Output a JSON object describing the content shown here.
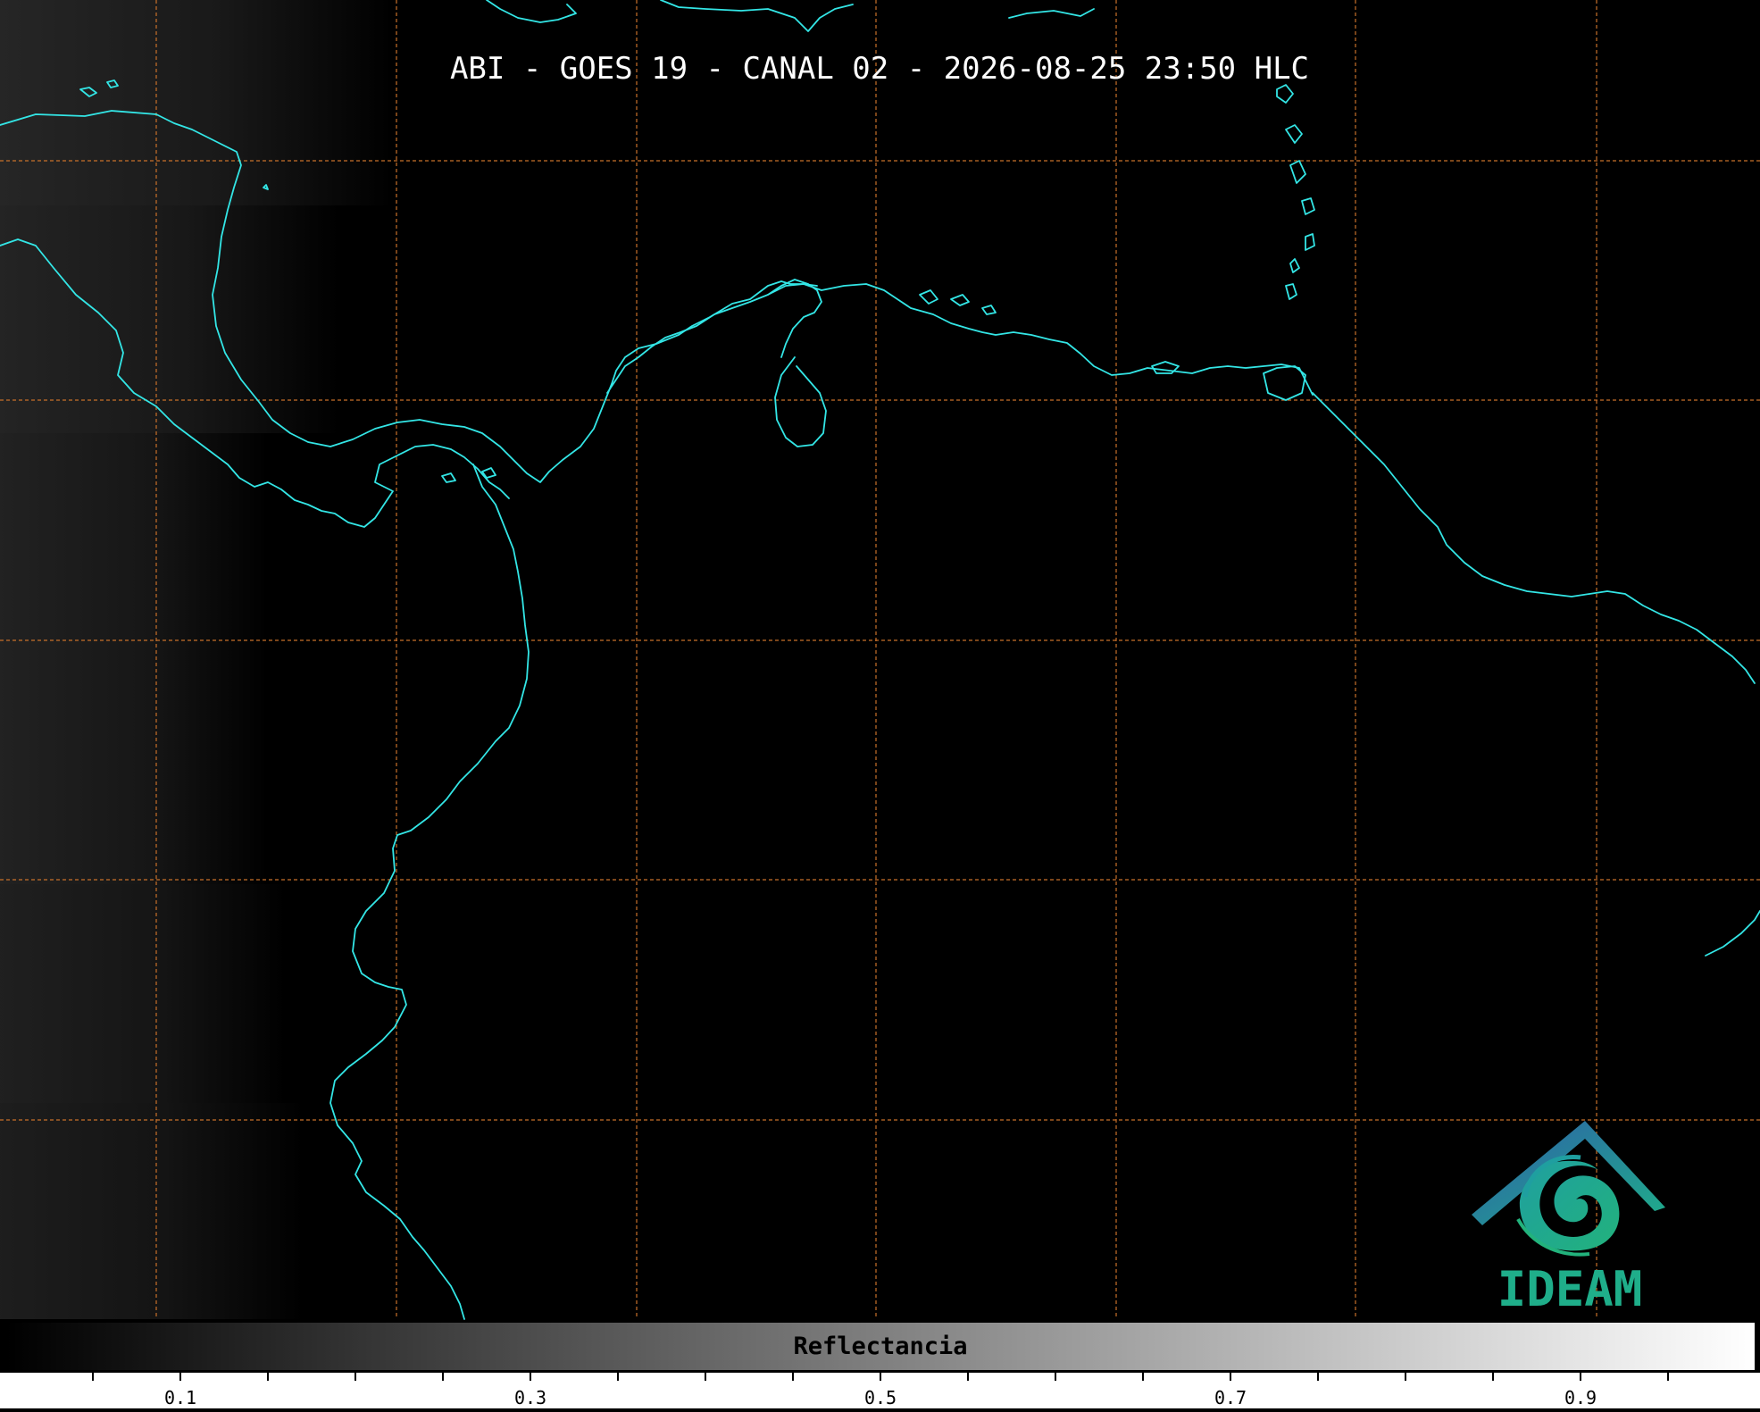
{
  "map": {
    "title": "ABI - GOES 19 - CANAL 02 - 2026-08-25 23:50 HLC",
    "background_color": "#000000",
    "coastline_color": "#33e6e6",
    "gridline_color": "#c8702a"
  },
  "colorbar": {
    "label": "Reflectancia",
    "ticks": [
      "0.1",
      "0.3",
      "0.5",
      "0.7",
      "0.9"
    ],
    "range": [
      0.0,
      1.0
    ],
    "colormap": [
      "#000000",
      "#ffffff"
    ]
  },
  "logo": {
    "text": "IDEAM",
    "color": "#1fae8a",
    "roof_color": "#2d6fae"
  }
}
